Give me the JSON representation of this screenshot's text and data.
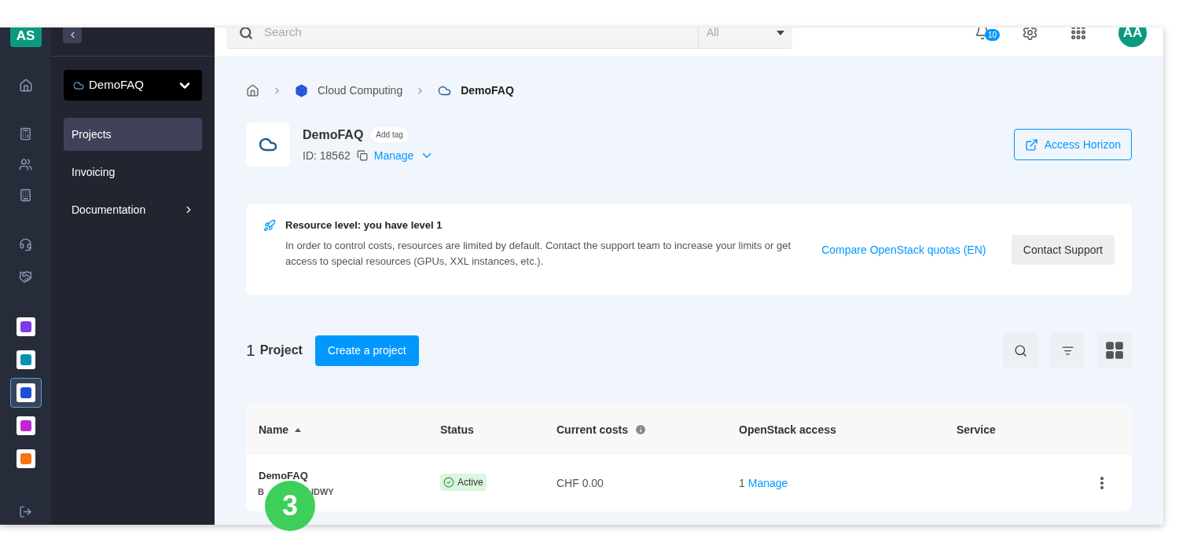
{
  "rail": {
    "avatar": "AS",
    "apps": [
      {
        "color": "#7c3aed",
        "selected": false
      },
      {
        "color": "#0891b2",
        "selected": false
      },
      {
        "color": "#1d4ed8",
        "selected": true
      },
      {
        "color": "#c026d3",
        "selected": false
      },
      {
        "color": "#f97316",
        "selected": false
      }
    ]
  },
  "nav": {
    "project_select": "DemoFAQ",
    "items": [
      {
        "label": "Projects",
        "selected": true,
        "expandable": false
      },
      {
        "label": "Invoicing",
        "selected": false,
        "expandable": false
      },
      {
        "label": "Documentation",
        "selected": false,
        "expandable": true
      }
    ]
  },
  "topbar": {
    "search": {
      "placeholder": "Search"
    },
    "scope": "All",
    "notifications": "10",
    "avatar": "AA"
  },
  "breadcrumb": [
    {
      "label": "Cloud Computing",
      "current": false
    },
    {
      "label": "DemoFAQ",
      "current": true
    }
  ],
  "header": {
    "title": "DemoFAQ",
    "tag": "Add tag",
    "id": "ID: 18562",
    "manage": "Manage",
    "action": "Access Horizon"
  },
  "notice": {
    "title": "Resource level: you have level 1",
    "body": "In order to control costs, resources are limited by default. Contact the support team to increase your limits or get access to special resources (GPUs, XXL instances, etc.).",
    "link": "Compare OpenStack quotas (EN)",
    "button": "Contact Support"
  },
  "projects": {
    "count": "1",
    "label": "Project",
    "create": "Create a project"
  },
  "table": {
    "columns": [
      {
        "label": "Name",
        "sorted": true,
        "info": false
      },
      {
        "label": "Status",
        "sorted": false,
        "info": false
      },
      {
        "label": "Current costs",
        "sorted": false,
        "info": true
      },
      {
        "label": "OpenStack access",
        "sorted": false,
        "info": false
      },
      {
        "label": "Service",
        "sorted": false,
        "info": false
      }
    ],
    "rows": [
      {
        "name": "DemoFAQ",
        "id_start": "B",
        "id_end": "IDWY",
        "status": "Active",
        "cost": "CHF 0.00",
        "access_count": "1",
        "access_link": "Manage"
      }
    ]
  },
  "step_badge": "3"
}
